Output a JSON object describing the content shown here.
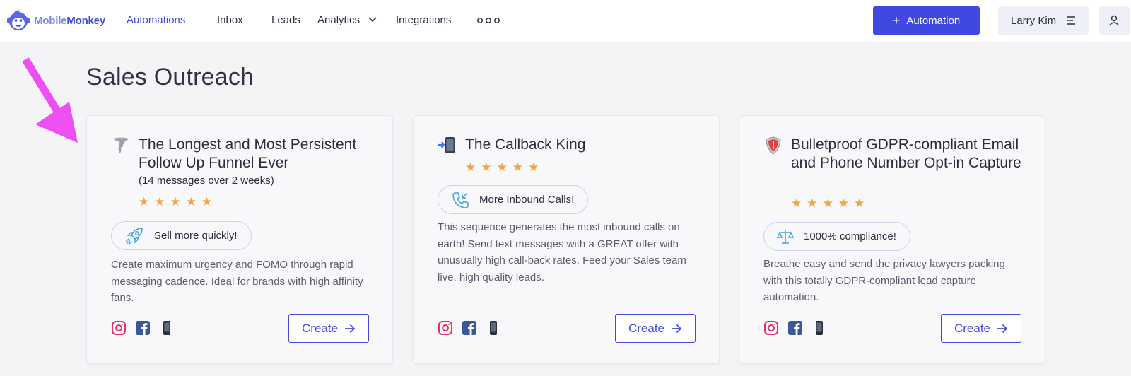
{
  "nav": {
    "brand_part1": "Mobile",
    "brand_part2": "Monkey",
    "links": [
      "Automations",
      "Inbox",
      "Leads",
      "Analytics",
      "Integrations"
    ],
    "new_button": "Automation",
    "user_name": "Larry Kim"
  },
  "page": {
    "title": "Sales Outreach"
  },
  "cards": [
    {
      "emoji": "tornado",
      "title": "The Longest and Most Persistent Follow Up Funnel Ever",
      "subtitle": "(14 messages over 2 weeks)",
      "rating": 5,
      "badge": "Sell more quickly!",
      "badge_icon": "rocket-icon",
      "description": "Create maximum urgency and FOMO through rapid messaging cadence. Ideal for brands with high affinity fans.",
      "channels": [
        "instagram",
        "facebook",
        "sms"
      ],
      "cta": "Create"
    },
    {
      "emoji": "mobile-phone-with-arrow",
      "title": "The Callback King",
      "subtitle": "",
      "rating": 5,
      "badge": "More Inbound Calls!",
      "badge_icon": "phone-incoming-icon",
      "description": "This sequence generates the most inbound calls on earth! Send text messages with a GREAT offer with unusually high call-back rates. Feed your Sales team live, high quality leads.",
      "channels": [
        "instagram",
        "facebook",
        "sms"
      ],
      "cta": "Create"
    },
    {
      "emoji": "shield",
      "title": "Bulletproof GDPR-compliant Email and Phone Number Opt-in Capture",
      "subtitle": "",
      "rating": 5,
      "badge": "1000% compliance!",
      "badge_icon": "scales-icon",
      "description": "Breathe easy and send the privacy lawyers packing with this totally GDPR-compliant lead capture automation.",
      "channels": [
        "instagram",
        "facebook",
        "sms"
      ],
      "cta": "Create"
    }
  ],
  "colors": {
    "accent": "#3f48e0",
    "star": "#f3a53e",
    "annotation_arrow": "#ee4ff0"
  }
}
